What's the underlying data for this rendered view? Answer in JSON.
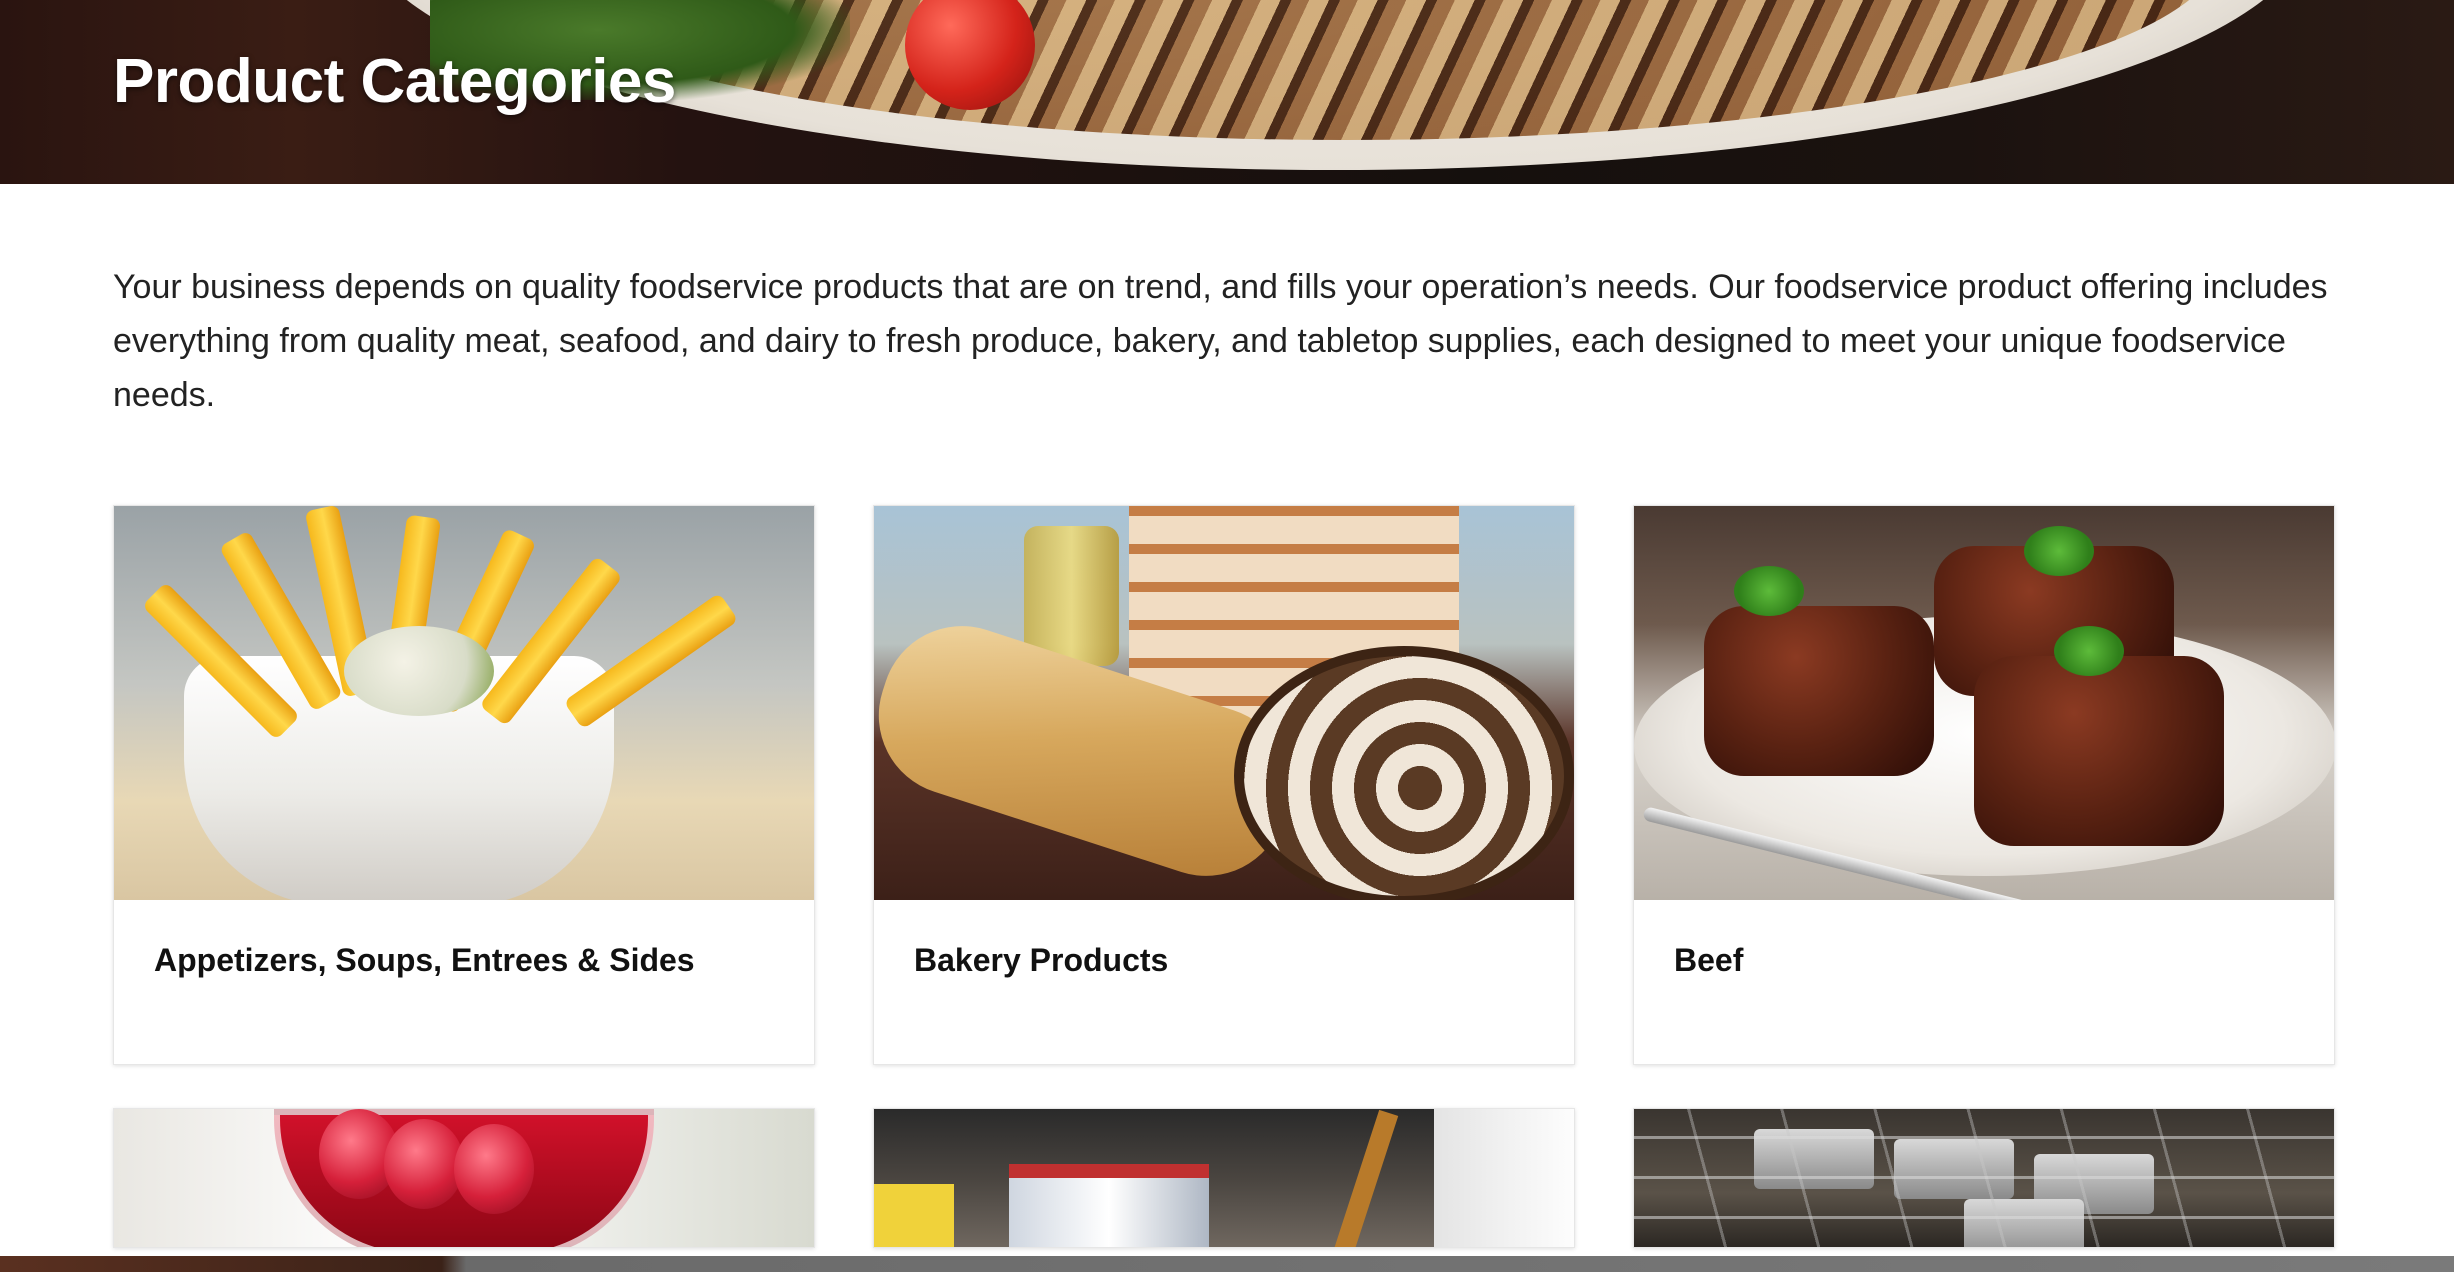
{
  "hero": {
    "title": "Product Categories"
  },
  "intro": {
    "text": "Your business depends on quality foodservice products that are on trend, and fills your operation’s needs. Our foodservice product offering includes everything from quality meat, seafood, and dairy to fresh produce, bakery, and tabletop supplies, each designed to meet your unique foodservice needs."
  },
  "categories": [
    {
      "title": "Appetizers, Soups, Entrees & Sides",
      "image": "fries-bowl-photo"
    },
    {
      "title": "Bakery Products",
      "image": "bread-loaves-photo"
    },
    {
      "title": "Beef",
      "image": "beef-plate-photo"
    },
    {
      "title": "",
      "image": "raspberry-dessert-photo"
    },
    {
      "title": "",
      "image": "kitchen-cleaning-photo"
    },
    {
      "title": "",
      "image": "steel-shelves-photo"
    }
  ]
}
